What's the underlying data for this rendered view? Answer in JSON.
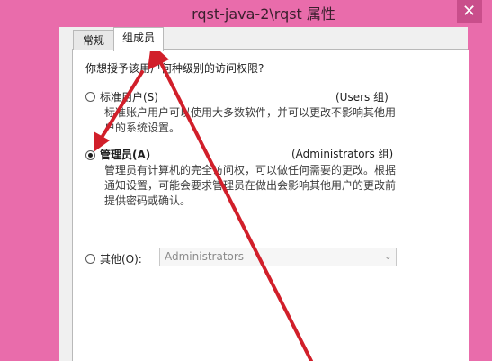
{
  "window": {
    "title": "rqst-java-2\\rqst 属性",
    "close_glyph": "✕"
  },
  "tabs": [
    {
      "label": "常规"
    },
    {
      "label": "组成员"
    }
  ],
  "panel": {
    "question": "你想授予该用户何种级别的访问权限?",
    "options": [
      {
        "label": "标准用户(S)",
        "group": "(Users 组)",
        "description": [
          "标准账户用户可以使用大多数软件，并可以更改不影响其他用",
          "户的系统设置。"
        ],
        "checked": false
      },
      {
        "label": "管理员(A)",
        "group": "(Administrators 组)",
        "description": [
          "管理员有计算机的完全访问权，可以做任何需要的更改。根据",
          "通知设置，可能会要求管理员在做出会影响其他用户的更改前",
          "提供密码或确认。"
        ],
        "checked": true
      },
      {
        "label": "其他(O):",
        "checked": false
      }
    ],
    "other_select": {
      "value": "Administrators",
      "caret": "⌄"
    }
  },
  "colors": {
    "frame": "#e96cab",
    "arrow": "#d11f2a"
  }
}
